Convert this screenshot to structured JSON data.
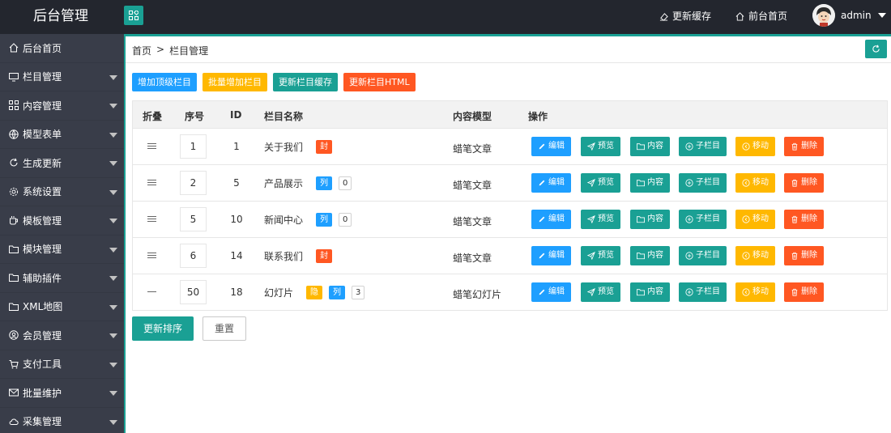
{
  "header": {
    "logo": "后台管理",
    "update_cache": "更新缓存",
    "front_home": "前台首页",
    "admin": "admin"
  },
  "sidebar": {
    "items": [
      {
        "label": "后台首页",
        "icon": "home-icon",
        "caret": false
      },
      {
        "label": "栏目管理",
        "icon": "monitor-icon",
        "caret": true
      },
      {
        "label": "内容管理",
        "icon": "apps-icon",
        "caret": true
      },
      {
        "label": "模型表单",
        "icon": "globe-icon",
        "caret": true
      },
      {
        "label": "生成更新",
        "icon": "refresh-icon",
        "caret": true
      },
      {
        "label": "系统设置",
        "icon": "gear-icon",
        "caret": true
      },
      {
        "label": "模板管理",
        "icon": "cup-icon",
        "caret": true
      },
      {
        "label": "模块管理",
        "icon": "folder-icon",
        "caret": true
      },
      {
        "label": "辅助插件",
        "icon": "folder-icon",
        "caret": true
      },
      {
        "label": "XML地图",
        "icon": "folder-icon",
        "caret": true
      },
      {
        "label": "会员管理",
        "icon": "user-icon",
        "caret": true
      },
      {
        "label": "支付工具",
        "icon": "cart-icon",
        "caret": true
      },
      {
        "label": "批量维护",
        "icon": "mail-icon",
        "caret": true
      },
      {
        "label": "采集管理",
        "icon": "cloud-icon",
        "caret": true
      }
    ]
  },
  "breadcrumb": {
    "home": "首页",
    "sep": ">",
    "current": "栏目管理"
  },
  "toolbar": {
    "add_top": "增加顶级栏目",
    "batch_add": "批量增加栏目",
    "update_cache": "更新栏目缓存",
    "update_html": "更新栏目HTML"
  },
  "table": {
    "headers": {
      "fold": "折叠",
      "sort": "序号",
      "id": "ID",
      "name": "栏目名称",
      "model": "内容模型",
      "ops": "操作"
    },
    "rows": [
      {
        "fold": "lines",
        "sort": "1",
        "id": "1",
        "name": "关于我们",
        "tags": [
          {
            "text": "封",
            "color": "#ff5722"
          }
        ],
        "count": "",
        "model": "蜡笔文章"
      },
      {
        "fold": "lines",
        "sort": "2",
        "id": "5",
        "name": "产品展示",
        "tags": [
          {
            "text": "列",
            "color": "#1e9fff"
          }
        ],
        "count": "0",
        "model": "蜡笔文章"
      },
      {
        "fold": "lines",
        "sort": "5",
        "id": "10",
        "name": "新闻中心",
        "tags": [
          {
            "text": "列",
            "color": "#1e9fff"
          }
        ],
        "count": "0",
        "model": "蜡笔文章"
      },
      {
        "fold": "lines",
        "sort": "6",
        "id": "14",
        "name": "联系我们",
        "tags": [
          {
            "text": "封",
            "color": "#ff5722"
          }
        ],
        "count": "",
        "model": "蜡笔文章"
      },
      {
        "fold": "dash",
        "sort": "50",
        "id": "18",
        "name": "幻灯片",
        "tags": [
          {
            "text": "隐",
            "color": "#ffb800"
          },
          {
            "text": "列",
            "color": "#1e9fff"
          }
        ],
        "count": "3",
        "model": "蜡笔幻灯片"
      }
    ],
    "ops": [
      {
        "label": "编辑",
        "color": "#1e9fff",
        "icon": "edit-icon",
        "gap": 12
      },
      {
        "label": "预览",
        "color": "#1aa094",
        "icon": "send-icon",
        "gap": 12
      },
      {
        "label": "内容",
        "color": "#1aa094",
        "icon": "folder-icon",
        "gap": 11
      },
      {
        "label": "子栏目",
        "color": "#1aa094",
        "icon": "add-circle-icon",
        "gap": 11
      },
      {
        "label": "移动",
        "color": "#ffb800",
        "icon": "move-icon",
        "gap": 11
      },
      {
        "label": "删除",
        "color": "#ff5722",
        "icon": "trash-icon",
        "gap": 0
      }
    ]
  },
  "footer": {
    "update_sort": "更新排序",
    "reset": "重置"
  }
}
